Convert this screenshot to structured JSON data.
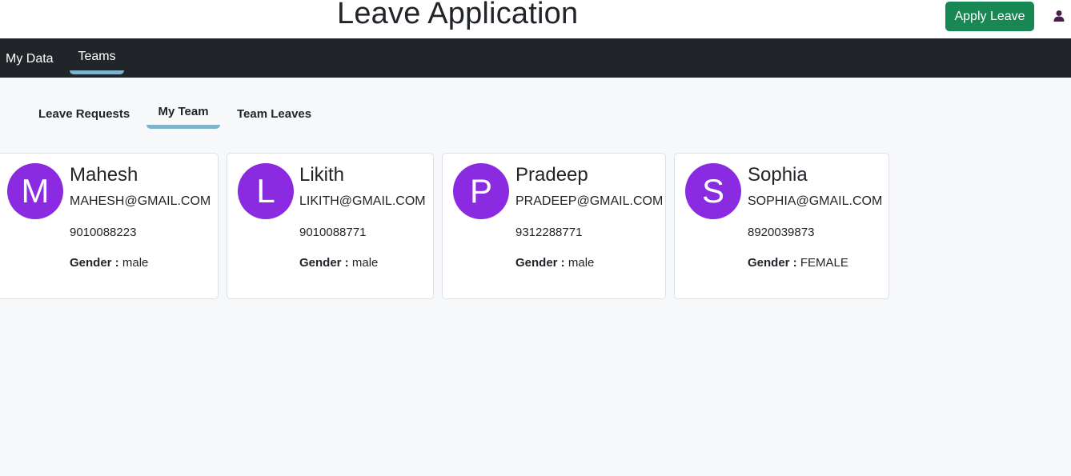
{
  "header": {
    "title": "Leave Application",
    "apply_button": "Apply Leave",
    "user_icon": "user-icon"
  },
  "nav": {
    "items": [
      {
        "label": "My Data",
        "active": false
      },
      {
        "label": "Teams",
        "active": true
      }
    ]
  },
  "subtabs": {
    "items": [
      {
        "label": "Leave Requests",
        "active": false
      },
      {
        "label": "My Team",
        "active": true
      },
      {
        "label": "Team Leaves",
        "active": false
      }
    ]
  },
  "team": {
    "gender_label": "Gender :",
    "members": [
      {
        "initial": "M",
        "name": "Mahesh",
        "email": "MAHESH@GMAIL.COM",
        "phone": "9010088223",
        "gender": "male"
      },
      {
        "initial": "L",
        "name": "Likith",
        "email": "LIKITH@GMAIL.COM",
        "phone": "9010088771",
        "gender": "male"
      },
      {
        "initial": "P",
        "name": "Pradeep",
        "email": "PRADEEP@GMAIL.COM",
        "phone": "9312288771",
        "gender": "male"
      },
      {
        "initial": "S",
        "name": "Sophia",
        "email": "SOPHIA@GMAIL.COM",
        "phone": "8920039873",
        "gender": "FEMALE"
      }
    ]
  },
  "colors": {
    "accent": "#198754",
    "navbar": "#212529",
    "avatar": "#8a2be2",
    "active_underline": "#7fb3cc",
    "user_icon": "#4a1e4a"
  }
}
